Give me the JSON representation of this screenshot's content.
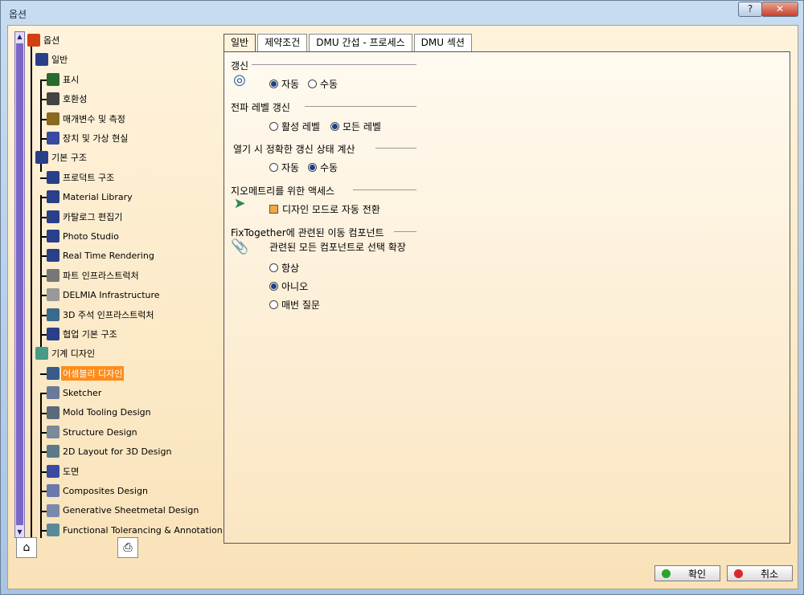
{
  "window": {
    "title": "옵션",
    "help_label": "?",
    "close_label": "✕"
  },
  "tree": {
    "nodes": [
      {
        "id": "root",
        "label": "옵션",
        "icon": "options-root-icon",
        "color": "#d04010"
      },
      {
        "id": "general",
        "label": "일반",
        "icon": "general-icon",
        "color": "#2a3f8a"
      },
      {
        "id": "display",
        "label": "표시",
        "icon": "display-icon",
        "color": "#2a6a30"
      },
      {
        "id": "compat",
        "label": "호환성",
        "icon": "compatibility-icon",
        "color": "#444"
      },
      {
        "id": "params",
        "label": "매개변수 및 측정",
        "icon": "parameters-icon",
        "color": "#8a6a20"
      },
      {
        "id": "devices",
        "label": "장치 및 가상 현실",
        "icon": "devices-icon",
        "color": "#3a4aa0"
      },
      {
        "id": "infra",
        "label": "기본 구조",
        "icon": "infrastructure-icon",
        "color": "#2a3f8a"
      },
      {
        "id": "product",
        "label": "프로덕트 구조",
        "icon": "product-structure-icon",
        "color": "#2a3f8a"
      },
      {
        "id": "material",
        "label": "Material Library",
        "icon": "material-library-icon",
        "color": "#2a3f8a"
      },
      {
        "id": "catalog",
        "label": "카탈로그 편집기",
        "icon": "catalog-editor-icon",
        "color": "#2a3f8a"
      },
      {
        "id": "photo",
        "label": "Photo Studio",
        "icon": "photo-studio-icon",
        "color": "#2a3f8a"
      },
      {
        "id": "rtr",
        "label": "Real Time Rendering",
        "icon": "rendering-icon",
        "color": "#2a3f8a"
      },
      {
        "id": "part",
        "label": "파트 인프라스트럭처",
        "icon": "part-infra-icon",
        "color": "#777"
      },
      {
        "id": "delmia",
        "label": "DELMIA Infrastructure",
        "icon": "delmia-icon",
        "color": "#999"
      },
      {
        "id": "annot3d",
        "label": "3D 주석 인프라스트럭처",
        "icon": "annotation-3d-icon",
        "color": "#3a6a8a"
      },
      {
        "id": "collab",
        "label": "협업 기본 구조",
        "icon": "collaboration-icon",
        "color": "#2a3f8a"
      },
      {
        "id": "mech",
        "label": "기계 디자인",
        "icon": "mechanical-design-icon",
        "color": "#4a9a8a"
      },
      {
        "id": "assembly",
        "label": "어셈블리 디자인",
        "icon": "assembly-design-icon",
        "color": "#3a5a8a",
        "selected": true
      },
      {
        "id": "sketcher",
        "label": "Sketcher",
        "icon": "sketcher-icon",
        "color": "#6a7a9a"
      },
      {
        "id": "mold",
        "label": "Mold Tooling Design",
        "icon": "mold-tooling-icon",
        "color": "#5a6a7a"
      },
      {
        "id": "structure",
        "label": "Structure Design",
        "icon": "structure-design-icon",
        "color": "#7a8a9a"
      },
      {
        "id": "layout2d",
        "label": "2D Layout for 3D Design",
        "icon": "layout-2d-icon",
        "color": "#5a7a8a"
      },
      {
        "id": "drawing",
        "label": "도면",
        "icon": "drawing-icon",
        "color": "#3a4aa0"
      },
      {
        "id": "composites",
        "label": "Composites Design",
        "icon": "composites-icon",
        "color": "#6a7aaa"
      },
      {
        "id": "sheetmetal",
        "label": "Generative Sheetmetal Design",
        "icon": "sheetmetal-icon",
        "color": "#7a8aaa"
      },
      {
        "id": "ft&a",
        "label": "Functional Tolerancing & Annotation",
        "icon": "tolerancing-icon",
        "color": "#5a8a9a"
      }
    ]
  },
  "tabs": [
    {
      "label": "일반",
      "active": true
    },
    {
      "label": "제약조건"
    },
    {
      "label": "DMU 간섭 - 프로세스"
    },
    {
      "label": "DMU 섹션"
    }
  ],
  "general": {
    "update_title": "갱신",
    "update_auto": "자동",
    "update_manual": "수동",
    "propagation_title": "전파 레벨 갱신",
    "propagation_active": "활성 레벨",
    "propagation_all": "모든 레벨",
    "open_title": "열기 시 정확한 갱신 상태 계산",
    "open_auto": "자동",
    "open_manual": "수동",
    "geometry_title": "지오메트리를 위한 액세스",
    "geometry_checkbox": "디자인 모드로 자동 전환",
    "fix_title": "FixTogether에 관련된 이동 컴포넌트",
    "fix_subtitle": "관련된 모든 컴포넌트로 선택 확장",
    "fix_always": "항상",
    "fix_no": "아니오",
    "fix_ask": "매번 질문"
  },
  "buttons": {
    "ok": "확인",
    "cancel": "취소"
  },
  "colors": {
    "ok": "#2aa52a",
    "cancel": "#d42a2a",
    "selected": "#ff8c1a"
  }
}
